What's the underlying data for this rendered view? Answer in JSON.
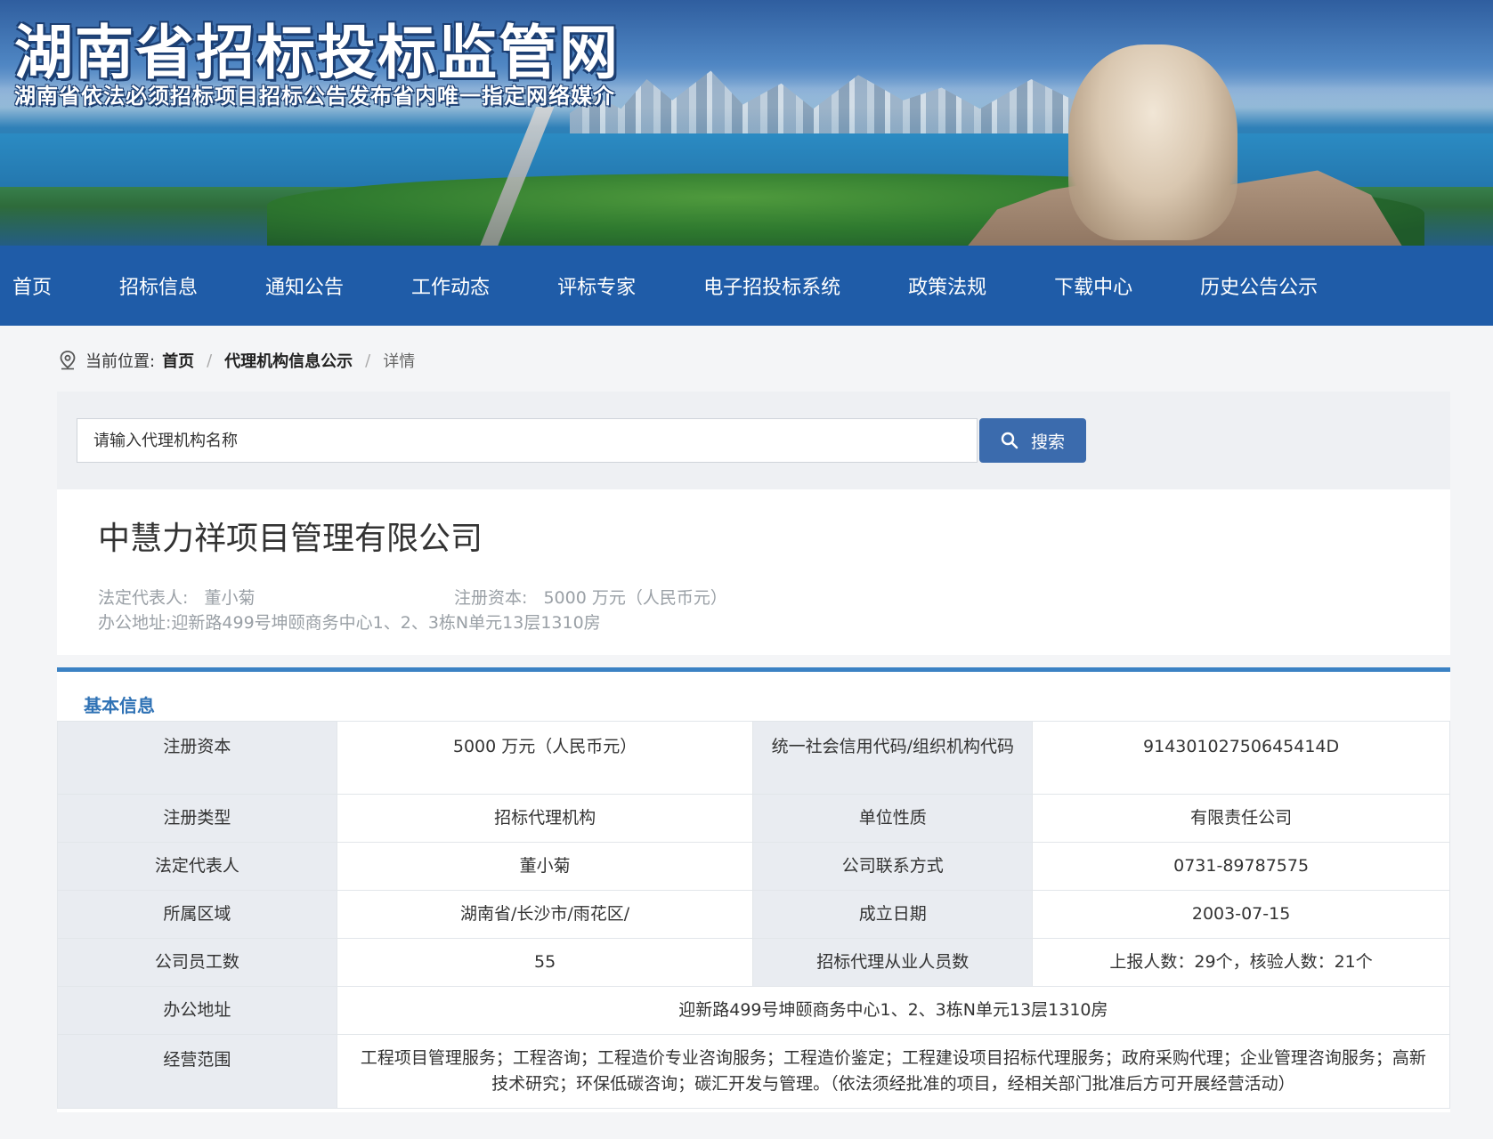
{
  "header": {
    "site_title": "湖南省招标投标监管网",
    "site_subtitle": "湖南省依法必须招标项目招标公告发布省内唯一指定网络媒介"
  },
  "nav": {
    "items": [
      {
        "label": "首页",
        "active": true
      },
      {
        "label": "招标信息"
      },
      {
        "label": "通知公告"
      },
      {
        "label": "工作动态"
      },
      {
        "label": "评标专家"
      },
      {
        "label": "电子招投标系统"
      },
      {
        "label": "政策法规"
      },
      {
        "label": "下载中心"
      },
      {
        "label": "历史公告公示"
      }
    ]
  },
  "breadcrumb": {
    "prefix": "当前位置:",
    "home": "首页",
    "section": "代理机构信息公示",
    "current": "详情",
    "separator": "/"
  },
  "search": {
    "placeholder": "请输入代理机构名称",
    "button_label": "搜索"
  },
  "company": {
    "name": "中慧力祥项目管理有限公司",
    "legal_rep_label": "法定代表人:",
    "legal_rep": "董小菊",
    "capital_label": "注册资本:",
    "capital": "5000 万元（人民币元）",
    "address_label": "办公地址:",
    "address": "迎新路499号坤颐商务中心1、2、3栋N单元13层1310房"
  },
  "basic_info": {
    "title": "基本信息",
    "rows": [
      {
        "label1": "注册资本",
        "value1": "5000 万元（人民币元）",
        "label2": "统一社会信用代码/组织机构代码",
        "value2": "91430102750645414D"
      },
      {
        "label1": "注册类型",
        "value1": "招标代理机构",
        "label2": "单位性质",
        "value2": "有限责任公司"
      },
      {
        "label1": "法定代表人",
        "value1": "董小菊",
        "label2": "公司联系方式",
        "value2": "0731-89787575"
      },
      {
        "label1": "所属区域",
        "value1": "湖南省/长沙市/雨花区/",
        "label2": "成立日期",
        "value2": "2003-07-15"
      },
      {
        "label1": "公司员工数",
        "value1": "55",
        "label2": "招标代理从业人员数",
        "value2": "上报人数：29个，核验人数：21个"
      }
    ],
    "address_label": "办公地址",
    "address_value": "迎新路499号坤颐商务中心1、2、3栋N单元13层1310房",
    "scope_label": "经营范围",
    "scope_value": "工程项目管理服务；工程咨询；工程造价专业咨询服务；工程造价鉴定；工程建设项目招标代理服务；政府采购代理；企业管理咨询服务；高新技术研究；环保低碳咨询；碳汇开发与管理。（依法须经批准的项目，经相关部门批准后方可开展经营活动）"
  },
  "colors": {
    "nav_bg": "#1f5ca8",
    "accent": "#3b82c4",
    "search_button": "#3b6bad",
    "label_cell_bg": "#e9ecf1"
  }
}
